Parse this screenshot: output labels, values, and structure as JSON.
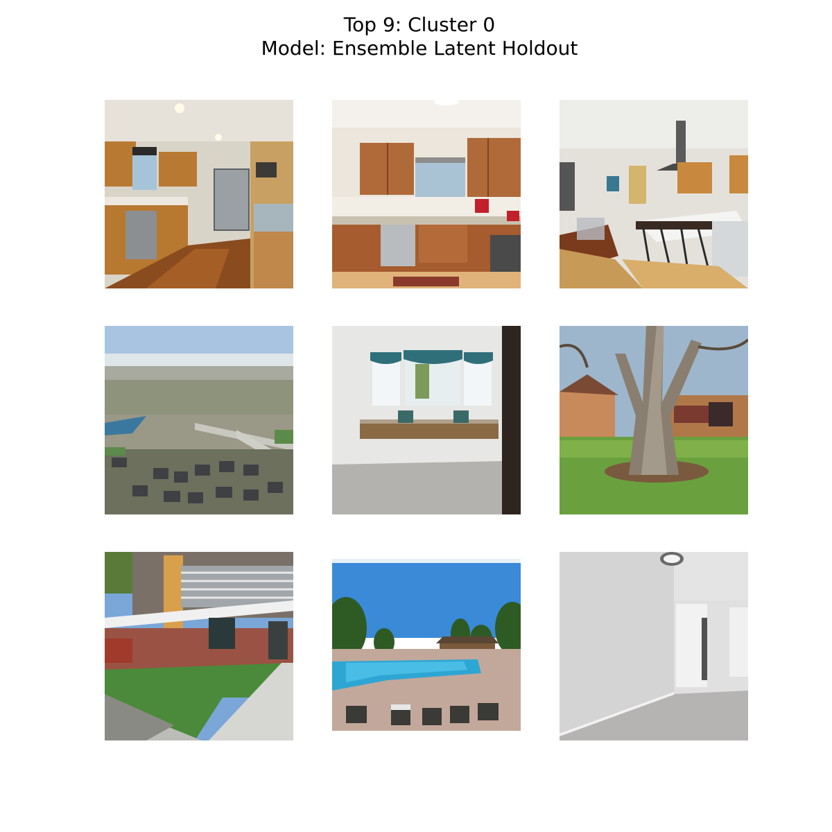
{
  "figure": {
    "title_line1": "Top 9: Cluster 0",
    "title_line2": "Model: Ensemble Latent Holdout"
  },
  "images": [
    {
      "name": "kitchen-wood-floor"
    },
    {
      "name": "kitchen-cherry-cabinets"
    },
    {
      "name": "open-kitchen-island"
    },
    {
      "name": "aerial-neighborhood"
    },
    {
      "name": "bay-window-room"
    },
    {
      "name": "large-tree-yard"
    },
    {
      "name": "modern-townhouse-exterior"
    },
    {
      "name": "community-pool"
    },
    {
      "name": "empty-gray-room"
    }
  ]
}
